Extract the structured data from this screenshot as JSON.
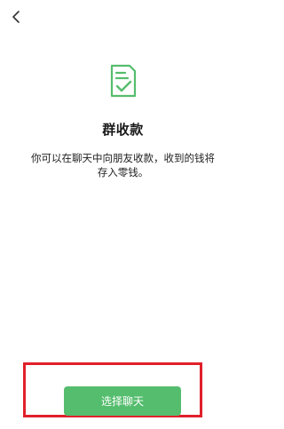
{
  "nav": {
    "back_icon": "chevron-left-icon"
  },
  "hero": {
    "icon": "document-check-icon",
    "icon_color": "#55bd6e"
  },
  "content": {
    "title": "群收款",
    "description_line1": "你可以在聊天中向朋友收款，收到的钱将",
    "description_line2": "存入零钱。"
  },
  "action": {
    "button_label": "选择聊天",
    "button_color": "#55bd6e",
    "highlight_color": "#e0202a"
  }
}
